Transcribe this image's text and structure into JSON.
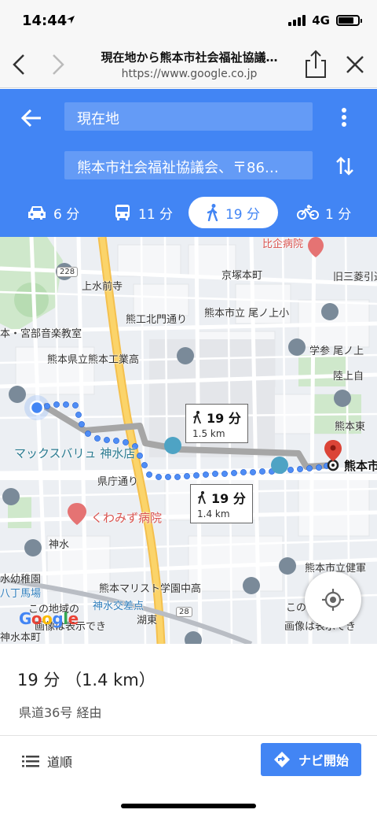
{
  "status_bar": {
    "time": "14:44",
    "network": "4G",
    "battery_level": 0.8
  },
  "browser": {
    "title": "現在地から熊本市社会福祉協議…",
    "url": "https://www.google.co.jp"
  },
  "directions": {
    "origin": "現在地",
    "destination": "熊本市社会福祉協議会、〒86…",
    "modes": [
      {
        "name": "drive",
        "icon": "car-icon",
        "time": "6 分"
      },
      {
        "name": "transit",
        "icon": "bus-icon",
        "time": "11 分"
      },
      {
        "name": "walk",
        "icon": "walking-icon",
        "time": "19 分",
        "selected": true
      },
      {
        "name": "bike",
        "icon": "bicycle-icon",
        "time": "1 分"
      }
    ]
  },
  "map": {
    "labels": {
      "hospital_top": "比企病院",
      "kyobashi": "京塚本町",
      "ni_sanriki": "旧三菱引込",
      "road_228": "228",
      "kamimizumae": "上水前寺",
      "kitamon": "熊工北門通り",
      "music": "本・宮部音楽教室",
      "school_onoue": "熊本市立 尾ノ上小",
      "kogyo": "熊本県立熊本工業高",
      "gakusan": "学参 尾ノ上",
      "land": "陸上自",
      "kumahigashi": "熊本東",
      "maxvalu": "マックスバリュ 神水店",
      "kenchou_dori": "県庁通り",
      "dest_label": "熊本市",
      "kuwamizu": "くわみず病院",
      "shinsui": "神水",
      "kindergarten": "水幼稚園",
      "hachoba": "八丁馬場",
      "marist": "熊本マリスト学園中高",
      "kenkou": "熊本市立健軍",
      "shinsui_crossing": "神水交差点",
      "road_28": "28",
      "kodo": "湖東",
      "no_display_left": "この地域の",
      "no_display_left2": "画像は表示でき",
      "no_display_right": "この地域の",
      "no_display_right2": "画像は表示でき",
      "hon_suiho": "神水本町",
      "mizu": "水"
    },
    "callout_alt": {
      "time": "19 分",
      "distance": "1.5 km"
    },
    "callout_main": {
      "time": "19 分",
      "distance": "1.4 km"
    },
    "google_logo": "Google"
  },
  "summary": {
    "time": "19 分 （1.4 km）",
    "via": "県道36号 経由"
  },
  "actions": {
    "steps_label": "道順",
    "start_label": "ナビ開始"
  }
}
